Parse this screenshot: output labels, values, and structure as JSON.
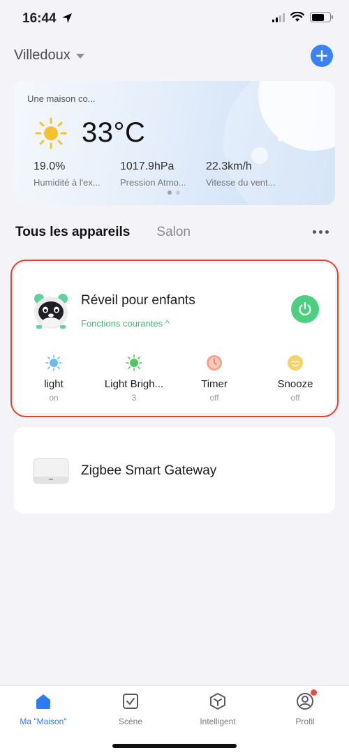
{
  "status_bar": {
    "time": "16:44"
  },
  "header": {
    "home_name": "Villedoux"
  },
  "weather": {
    "location": "Une maison co...",
    "temperature": "33°C",
    "metrics": [
      {
        "value": "19.0%",
        "label": "Humidité à l'ex..."
      },
      {
        "value": "1017.9hPa",
        "label": "Pression Atmo..."
      },
      {
        "value": "22.3km/h",
        "label": "Vitesse du vent..."
      }
    ]
  },
  "tabs": [
    {
      "label": "Tous les appareils",
      "active": true
    },
    {
      "label": "Salon",
      "active": false
    }
  ],
  "devices": [
    {
      "name": "Réveil pour enfants",
      "functions_label": "Fonctions courantes ^",
      "functions": [
        {
          "name": "light",
          "value": "on",
          "icon": "sun-blue-icon"
        },
        {
          "name": "Light Brigh...",
          "value": "3",
          "icon": "sun-green-icon"
        },
        {
          "name": "Timer",
          "value": "off",
          "icon": "timer-icon"
        },
        {
          "name": "Snooze",
          "value": "off",
          "icon": "snooze-icon"
        }
      ]
    },
    {
      "name": "Zigbee Smart Gateway"
    }
  ],
  "bottom_nav": [
    {
      "label": "Ma \"Maison\"",
      "icon": "home-icon",
      "active": true
    },
    {
      "label": "Scène",
      "icon": "scene-icon",
      "active": false
    },
    {
      "label": "Intelligent",
      "icon": "intelligent-icon",
      "active": false
    },
    {
      "label": "Profil",
      "icon": "profile-icon",
      "active": false
    }
  ],
  "colors": {
    "accent": "#2f7bf5",
    "power_on": "#4cd080",
    "functions_text": "#3cbd72",
    "highlight": "#e0452a"
  }
}
